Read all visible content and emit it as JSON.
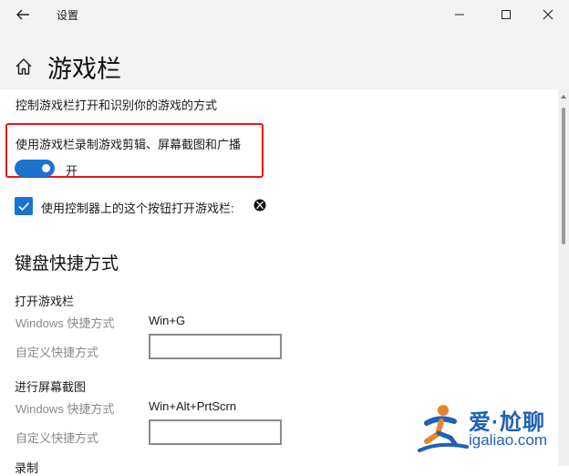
{
  "window": {
    "title": "设置",
    "back_icon": "arrow-left-icon",
    "controls": [
      "minimize-icon",
      "maximize-icon",
      "close-icon"
    ]
  },
  "header": {
    "page_title": "游戏栏",
    "home_icon": "home-icon"
  },
  "content": {
    "subtitle": "控制游戏栏打开和识别你的游戏的方式",
    "record_setting": {
      "label": "使用游戏栏录制游戏剪辑、屏幕截图和广播",
      "toggle_on": true,
      "toggle_state": "开"
    },
    "controller_setting": {
      "label": "使用控制器上的这个按钮打开游戏栏:",
      "checked": true,
      "icon": "xbox-icon"
    },
    "keyboard_section": {
      "heading": "键盘快捷方式",
      "groups": [
        {
          "title": "打开游戏栏",
          "windows_label": "Windows 快捷方式",
          "windows_value": "Win+G",
          "custom_label": "自定义快捷方式",
          "custom_value": ""
        },
        {
          "title": "进行屏幕截图",
          "windows_label": "Windows 快捷方式",
          "windows_value": "Win+Alt+PrtScrn",
          "custom_label": "自定义快捷方式",
          "custom_value": ""
        }
      ],
      "partial_next_title": "录制"
    }
  },
  "colors": {
    "accent": "#1a73d1",
    "highlight_border": "#e81818",
    "titlebar_bg": "#f3f3f3",
    "secondary_text": "#8a8a8a",
    "watermark": "#1f62b4"
  },
  "watermark": {
    "title": "爱·尬聊",
    "domain": "igaliao.com"
  }
}
